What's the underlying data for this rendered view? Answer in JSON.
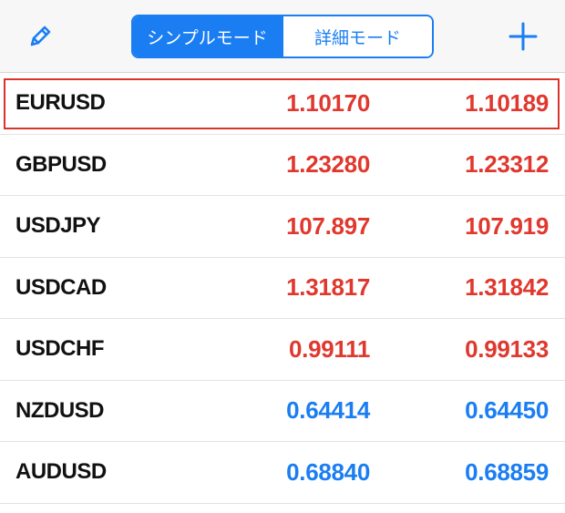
{
  "header": {
    "mode_tabs": [
      {
        "label": "シンプルモード",
        "active": true
      },
      {
        "label": "詳細モード",
        "active": false
      }
    ],
    "edit_icon": "pencil-icon",
    "add_icon": "plus-icon"
  },
  "colors": {
    "accent": "#1a7ef2",
    "price_down": "#e0382e",
    "price_up": "#1a7ef2",
    "selection_border": "#d9342b"
  },
  "quotes": [
    {
      "symbol": "EURUSD",
      "bid": "1.10170",
      "ask": "1.10189",
      "direction": "down",
      "selected": true
    },
    {
      "symbol": "GBPUSD",
      "bid": "1.23280",
      "ask": "1.23312",
      "direction": "down",
      "selected": false
    },
    {
      "symbol": "USDJPY",
      "bid": "107.897",
      "ask": "107.919",
      "direction": "down",
      "selected": false
    },
    {
      "symbol": "USDCAD",
      "bid": "1.31817",
      "ask": "1.31842",
      "direction": "down",
      "selected": false
    },
    {
      "symbol": "USDCHF",
      "bid": "0.99111",
      "ask": "0.99133",
      "direction": "down",
      "selected": false
    },
    {
      "symbol": "NZDUSD",
      "bid": "0.64414",
      "ask": "0.64450",
      "direction": "up",
      "selected": false
    },
    {
      "symbol": "AUDUSD",
      "bid": "0.68840",
      "ask": "0.68859",
      "direction": "up",
      "selected": false
    }
  ]
}
